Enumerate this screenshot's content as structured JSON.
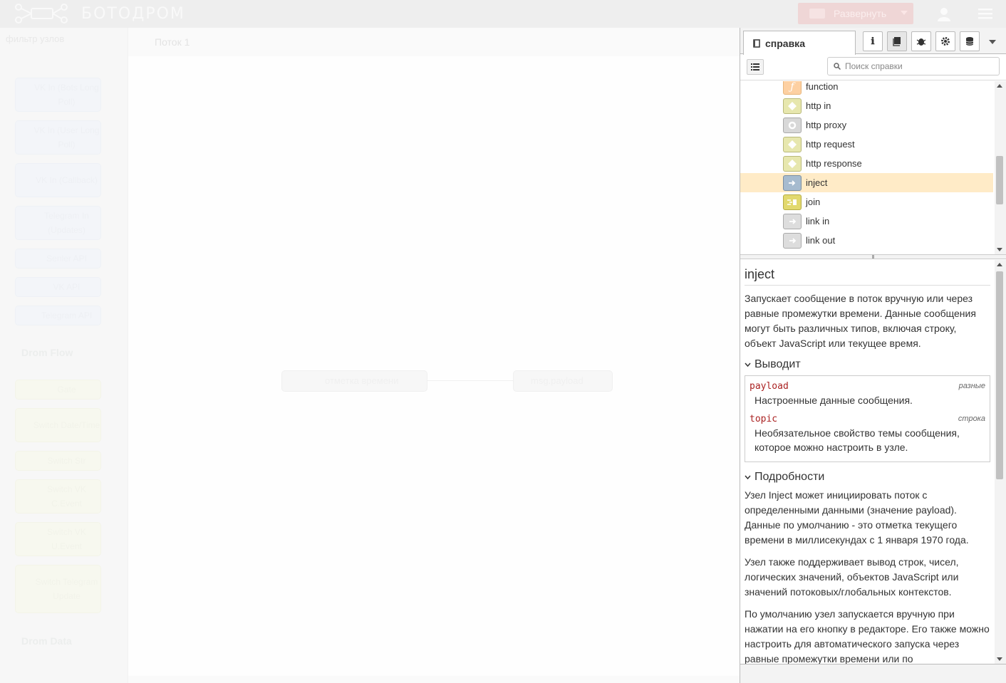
{
  "header": {
    "brand": "БОТОДРОМ",
    "deploy_label": "Развернуть"
  },
  "palette": {
    "search_placeholder": "фильтр узлов",
    "nodes_top": [
      "VK In (Bots Long Poll)",
      "VK In (User Long Poll)",
      "VK In (Callback)",
      "Telegram In (Updates)",
      "Senler API",
      "VK API",
      "Telegram API"
    ],
    "category_flow": "Drom Flow",
    "nodes_flow": [
      "Gate",
      "Switch Date/Time",
      "Switch Str",
      "Switch VK C.Event",
      "Switch VK U.Event",
      "Switch Telegram Update"
    ],
    "category_data": "Drom Data"
  },
  "workspace": {
    "tab_label": "Поток 1",
    "node_left": "отметка времени",
    "node_right": "msg.payload"
  },
  "sidebar": {
    "active_tab": "справка",
    "search_placeholder": "Поиск справки",
    "tree_items": [
      {
        "label": "function",
        "color": "#fdd0a2"
      },
      {
        "label": "http in",
        "color": "#e7e7ae"
      },
      {
        "label": "http proxy",
        "color": "#d8d8d8"
      },
      {
        "label": "http request",
        "color": "#e7e7ae"
      },
      {
        "label": "http response",
        "color": "#e7e7ae"
      },
      {
        "label": "inject",
        "color": "#a6bbcf"
      },
      {
        "label": "join",
        "color": "#e2d96e"
      },
      {
        "label": "link in",
        "color": "#dddddd"
      },
      {
        "label": "link out",
        "color": "#dddddd"
      }
    ],
    "selected_item": "inject"
  },
  "help": {
    "title": "inject",
    "intro": "Запускает сообщение в поток вручную или через равные промежутки времени. Данные сообщения могут быть различных типов, включая строку, объект JavaScript или текущее время.",
    "outputs_heading": "Выводит",
    "outputs": [
      {
        "name": "payload",
        "type": "разные",
        "desc": "Настроенные данные сообщения."
      },
      {
        "name": "topic",
        "type": "строка",
        "desc": "Необязательное свойство темы сообщения, которое можно настроить в узле."
      }
    ],
    "details_heading": "Подробности",
    "details": [
      "Узел Inject может инициировать поток с определенными данными (значение payload). Данные по умолчанию - это отметка текущего времени в миллисекундах с 1 января 1970 года.",
      "Узел также поддерживает вывод строк, чисел, логических значений, объектов JavaScript или значений потоковых/глобальных контекстов.",
      "По умолчанию узел запускается вручную при нажатии на его кнопку в редакторе. Его также можно настроить для автоматического запуска через равные промежутки времени или по"
    ]
  }
}
